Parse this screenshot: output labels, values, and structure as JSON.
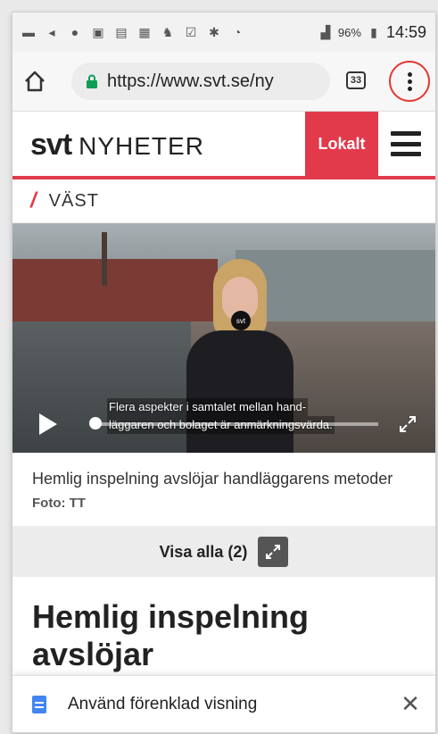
{
  "status_bar": {
    "battery": "96%",
    "time": "14:59",
    "icons": [
      "message-icon",
      "volume-icon",
      "messenger-icon",
      "image-icon",
      "dollar-icon",
      "gallery-icon",
      "evernote-icon",
      "checkbox-icon",
      "bluetooth-icon",
      "wifi-icon",
      "signal-icon"
    ]
  },
  "browser": {
    "url": "https://www.svt.se/ny",
    "tab_count": "33"
  },
  "site_header": {
    "logo_brand": "svt",
    "logo_section": "NYHETER",
    "lokalt_label": "Lokalt"
  },
  "region": {
    "label": "VÄST"
  },
  "video": {
    "subtitle_line1": "Flera aspekter i samtalet mellan hand-",
    "subtitle_line2": "läggaren och bolaget är anmärkningsvärda.",
    "mic_label": "svt"
  },
  "caption": {
    "text": "Hemlig inspelning avslöjar handläggarens metoder",
    "credit": "Foto: TT"
  },
  "gallery": {
    "show_all_label": "Visa alla (2)"
  },
  "article": {
    "headline": "Hemlig inspelning avslöjar"
  },
  "banner": {
    "text": "Använd förenklad visning"
  },
  "colors": {
    "accent": "#e23a4b",
    "menu_highlight": "#e53935",
    "doc_icon": "#4285f4"
  }
}
